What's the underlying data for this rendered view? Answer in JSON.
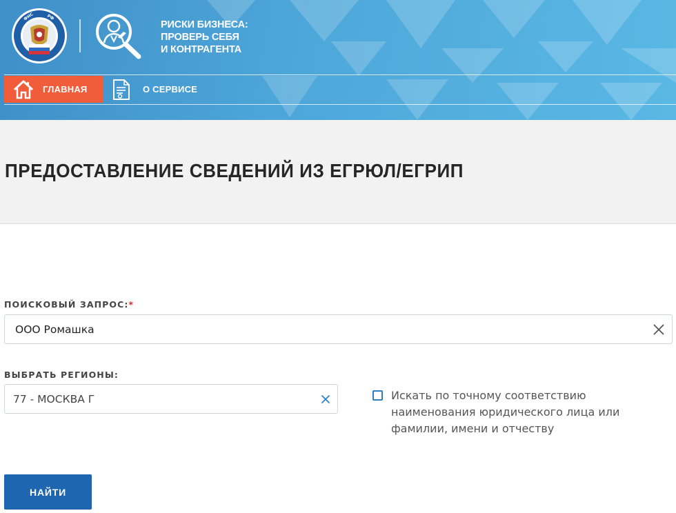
{
  "header": {
    "service_title_lines": [
      "РИСКИ БИЗНЕСА:",
      "ПРОВЕРЬ СЕБЯ",
      "И КОНТРАГЕНТА"
    ],
    "colors": {
      "header_bg": "#4ea7d9",
      "home_tab_bg": "#f15c3a"
    }
  },
  "nav": {
    "home_label": "ГЛАВНАЯ",
    "about_label": "О СЕРВИСЕ",
    "home_icon": "house-icon",
    "about_icon": "document-icon"
  },
  "page": {
    "title": "ПРЕДОСТАВЛЕНИЕ СВЕДЕНИЙ ИЗ ЕГРЮЛ/ЕГРИП"
  },
  "form": {
    "query_label": "ПОИСКОВЫЙ ЗАПРОС:",
    "query_required_mark": "*",
    "query_value": "ООО Ромашка",
    "region_label": "ВЫБРАТЬ РЕГИОНЫ:",
    "region_value": "77 - МОСКВА Г",
    "exact_match_text": "Искать по точному соответствию наименования юридического лица или фамилии, имени и отчеству",
    "exact_match_checked": false,
    "submit_label": "НАЙТИ",
    "colors": {
      "button_bg": "#1e67b0",
      "required": "#d9272e",
      "accent": "#2f7ec1"
    }
  }
}
